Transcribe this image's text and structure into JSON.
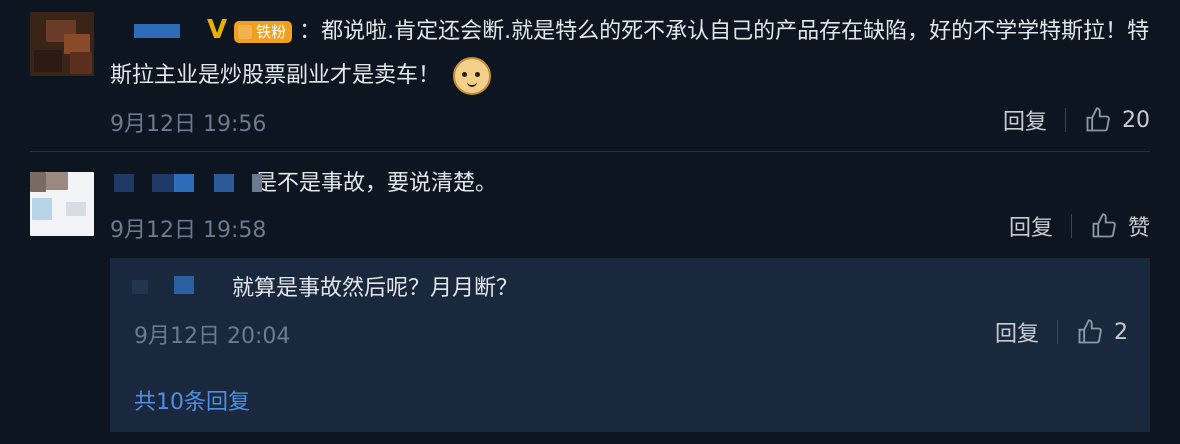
{
  "comments": [
    {
      "text": "：都说啦.肯定还会断.就是特么的死不承认自己的产品存在缺陷，好的不学学特斯拉！特斯拉主业是炒股票副业才是卖车！",
      "badge": "铁粉",
      "verified_mark": "V",
      "emoji": "doge-emoji",
      "timestamp": "9月12日 19:56",
      "reply_label": "回复",
      "like_count": "20"
    },
    {
      "text": "是不是事故，要说清楚。",
      "timestamp": "9月12日 19:58",
      "reply_label": "回复",
      "like_label": "赞",
      "reply": {
        "text": "就算是事故然后呢？月月断？",
        "timestamp": "9月12日 20:04",
        "reply_label": "回复",
        "like_count": "2"
      },
      "more_replies": "共10条回复"
    }
  ],
  "colors": {
    "background": "#0d1520",
    "reply_box": "#1a283d",
    "link": "#4f8fe3",
    "meta": "#6b7a8c",
    "badge": "#f0a020",
    "verified": "#e7b000"
  },
  "icons": [
    "thumbs-up-icon",
    "verified-icon",
    "fan-badge-icon",
    "doge-emoji"
  ]
}
